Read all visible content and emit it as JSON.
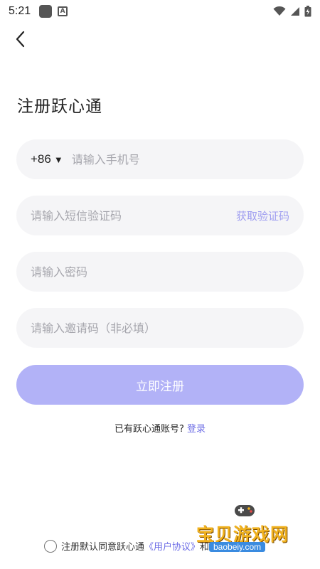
{
  "status_bar": {
    "time": "5:21",
    "a_icon": "A"
  },
  "header": {
    "back_icon": "chevron-left-icon"
  },
  "page": {
    "title": "注册跃心通"
  },
  "form": {
    "country_code": "+86",
    "country_arrow": "▼",
    "phone_placeholder": "请输入手机号",
    "code_placeholder": "请输入短信验证码",
    "get_code_label": "获取验证码",
    "password_placeholder": "请输入密码",
    "invite_placeholder": "请输入邀请码（非必填）",
    "register_label": "立即注册"
  },
  "login": {
    "prompt": "已有跃心通账号?",
    "link": "登录"
  },
  "agreement": {
    "text": "注册默认同意跃心通",
    "link": "《用户协议》",
    "suffix": "和"
  },
  "watermark": {
    "text": "宝贝游戏网",
    "url": "baobeiy.com"
  },
  "colors": {
    "accent": "#6c6ce6",
    "button": "#b2b2f7",
    "field_bg": "#f5f5f7"
  }
}
